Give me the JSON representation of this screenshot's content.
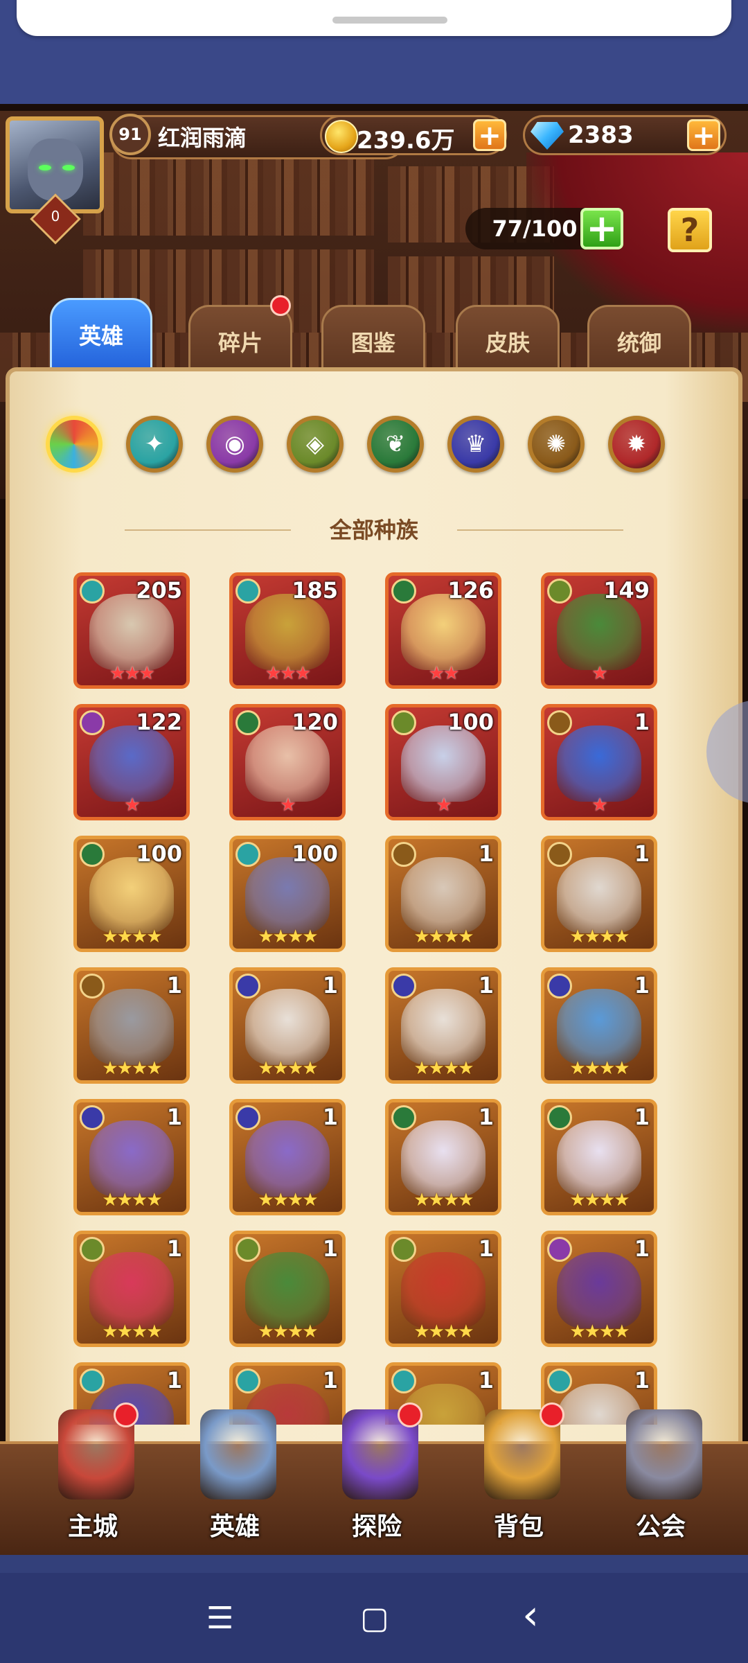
{
  "player": {
    "level": "91",
    "name": "红润雨滴",
    "rank": "0"
  },
  "currency": {
    "gold": "239.6万",
    "gems": "2383"
  },
  "hero_capacity": "77/100",
  "tabs": [
    {
      "label": "英雄",
      "active": true
    },
    {
      "label": "碎片",
      "badge": true
    },
    {
      "label": "图鉴"
    },
    {
      "label": "皮肤"
    },
    {
      "label": "统御"
    }
  ],
  "factions": [
    {
      "name": "all-factions",
      "color": "#f07a2a",
      "selected": true
    },
    {
      "name": "forest",
      "color": "#2aa3a3"
    },
    {
      "name": "shadow",
      "color": "#8a3aa8"
    },
    {
      "name": "fortress",
      "color": "#6b8a2a"
    },
    {
      "name": "nature",
      "color": "#2a7a3a"
    },
    {
      "name": "abyss",
      "color": "#3a3aa8"
    },
    {
      "name": "light",
      "color": "#8a5a1a"
    },
    {
      "name": "dark",
      "color": "#b0282a"
    }
  ],
  "race_title": "全部种族",
  "heroes": [
    {
      "level": "205",
      "stars": "★★★",
      "rarity": "r3",
      "element": "#2aa3a3",
      "portrait": "#d8c8b0"
    },
    {
      "level": "185",
      "stars": "★★★",
      "rarity": "r3",
      "element": "#2aa3a3",
      "portrait": "#c9a23a"
    },
    {
      "level": "126",
      "stars": "★★",
      "rarity": "r3",
      "element": "#2a7a3a",
      "portrait": "#f3d07a"
    },
    {
      "level": "149",
      "stars": "★",
      "rarity": "r3",
      "element": "#6b8a2a",
      "portrait": "#4a8a3a"
    },
    {
      "level": "122",
      "stars": "★",
      "rarity": "r3",
      "element": "#8a3aa8",
      "portrait": "#5a6ac8"
    },
    {
      "level": "120",
      "stars": "★",
      "rarity": "r3",
      "element": "#2a7a3a",
      "portrait": "#e8c0a8"
    },
    {
      "level": "100",
      "stars": "★",
      "rarity": "r3",
      "element": "#6b8a2a",
      "portrait": "#c8d0e8"
    },
    {
      "level": "1",
      "stars": "★",
      "rarity": "r3",
      "element": "#8a5a1a",
      "portrait": "#3a6ad8"
    },
    {
      "level": "100",
      "stars": "★★★★",
      "rarity": "r4",
      "element": "#2a7a3a",
      "portrait": "#f3d07a"
    },
    {
      "level": "100",
      "stars": "★★★★",
      "rarity": "r4",
      "element": "#2aa3a3",
      "portrait": "#7a7ab0"
    },
    {
      "level": "1",
      "stars": "★★★★",
      "rarity": "r4",
      "element": "#8a5a1a",
      "portrait": "#d8c8b8"
    },
    {
      "level": "1",
      "stars": "★★★★",
      "rarity": "r4",
      "element": "#8a5a1a",
      "portrait": "#e0d8d0"
    },
    {
      "level": "1",
      "stars": "★★★★",
      "rarity": "r4",
      "element": "#8a5a1a",
      "portrait": "#9a9aa0"
    },
    {
      "level": "1",
      "stars": "★★★★",
      "rarity": "r4",
      "element": "#3a3aa8",
      "portrait": "#e8e0d8"
    },
    {
      "level": "1",
      "stars": "★★★★",
      "rarity": "r4",
      "element": "#3a3aa8",
      "portrait": "#e8e0d8"
    },
    {
      "level": "1",
      "stars": "★★★★",
      "rarity": "r4",
      "element": "#3a3aa8",
      "portrait": "#5a9ad8"
    },
    {
      "level": "1",
      "stars": "★★★★",
      "rarity": "r4",
      "element": "#3a3aa8",
      "portrait": "#8a6ac8"
    },
    {
      "level": "1",
      "stars": "★★★★",
      "rarity": "r4",
      "element": "#3a3aa8",
      "portrait": "#8a6ac8"
    },
    {
      "level": "1",
      "stars": "★★★★",
      "rarity": "r4",
      "element": "#2a7a3a",
      "portrait": "#e8e0f0"
    },
    {
      "level": "1",
      "stars": "★★★★",
      "rarity": "r4",
      "element": "#2a7a3a",
      "portrait": "#e8e0f0"
    },
    {
      "level": "1",
      "stars": "★★★★",
      "rarity": "r4",
      "element": "#6b8a2a",
      "portrait": "#d83a5a"
    },
    {
      "level": "1",
      "stars": "★★★★",
      "rarity": "r4",
      "element": "#6b8a2a",
      "portrait": "#4a8a3a"
    },
    {
      "level": "1",
      "stars": "★★★★",
      "rarity": "r4",
      "element": "#6b8a2a",
      "portrait": "#c83a2a"
    },
    {
      "level": "1",
      "stars": "★★★★",
      "rarity": "r4",
      "element": "#8a3aa8",
      "portrait": "#6a3a9a"
    },
    {
      "level": "1",
      "stars": "",
      "rarity": "r4",
      "element": "#2aa3a3",
      "portrait": "#5a4ab0"
    },
    {
      "level": "1",
      "stars": "",
      "rarity": "r4",
      "element": "#2aa3a3",
      "portrait": "#b83a3a"
    },
    {
      "level": "1",
      "stars": "",
      "rarity": "r4",
      "element": "#2aa3a3",
      "portrait": "#c9a23a"
    },
    {
      "level": "1",
      "stars": "",
      "rarity": "r4",
      "element": "#2aa3a3",
      "portrait": "#e0d8d0"
    }
  ],
  "bottom_nav": [
    {
      "label": "主城",
      "badge": true,
      "color": "#c8483a"
    },
    {
      "label": "英雄",
      "badge": false,
      "color": "#7a9ac8"
    },
    {
      "label": "探险",
      "badge": true,
      "color": "#7a4ac8"
    },
    {
      "label": "背包",
      "badge": true,
      "color": "#e0a23a"
    },
    {
      "label": "公会",
      "badge": false,
      "color": "#8a8aa0"
    }
  ],
  "system_nav": {
    "menu": "☰",
    "home": "▢",
    "back": "‹"
  }
}
